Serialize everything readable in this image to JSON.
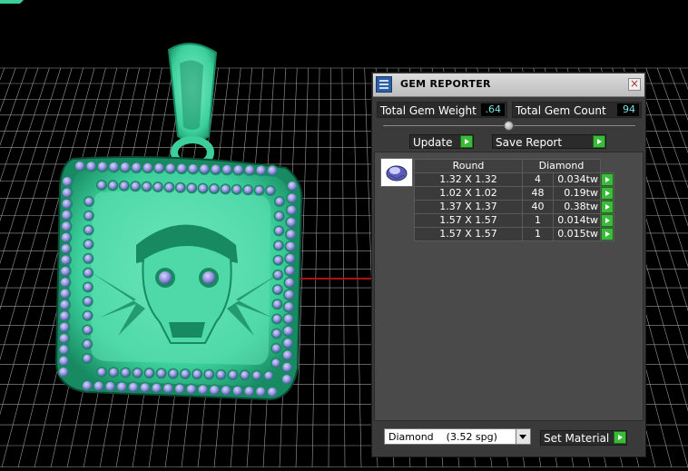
{
  "colors": {
    "viewport_bg": "#000000",
    "grid_line": "#9a9a9a",
    "red_axis": "#b01010",
    "metal": "#3ccf9c",
    "metal_dark": "#178a62",
    "gem_fill": "#8e8ed8",
    "gem_highlight": "#d6d8ff",
    "panel_bg": "#3a3a3a",
    "value_text": "#7be3e8",
    "go_button": "#3cba3c"
  },
  "panel": {
    "title": "GEM REPORTER",
    "title_icon": "report-icon",
    "close": "×",
    "total_weight_label": "Total Gem Weight",
    "total_weight_value": ".64",
    "total_count_label": "Total Gem Count",
    "total_count_value": "94",
    "slider_knob_fraction": 0.5,
    "update_label": "Update",
    "save_report_label": "Save Report",
    "table": {
      "headers": [
        "Round",
        "Diamond"
      ],
      "rows": [
        {
          "size": "1.32 X 1.32",
          "count": "4",
          "weight": "0.034tw"
        },
        {
          "size": "1.02 X 1.02",
          "count": "48",
          "weight": "0.19tw"
        },
        {
          "size": "1.37 X 1.37",
          "count": "40",
          "weight": "0.38tw"
        },
        {
          "size": "1.57 X 1.57",
          "count": "1",
          "weight": "0.014tw"
        },
        {
          "size": "1.57 X 1.57",
          "count": "1",
          "weight": "0.015tw"
        }
      ]
    },
    "material_select_value": "Diamond    (3.52 spg)",
    "set_material_label": "Set Material"
  }
}
